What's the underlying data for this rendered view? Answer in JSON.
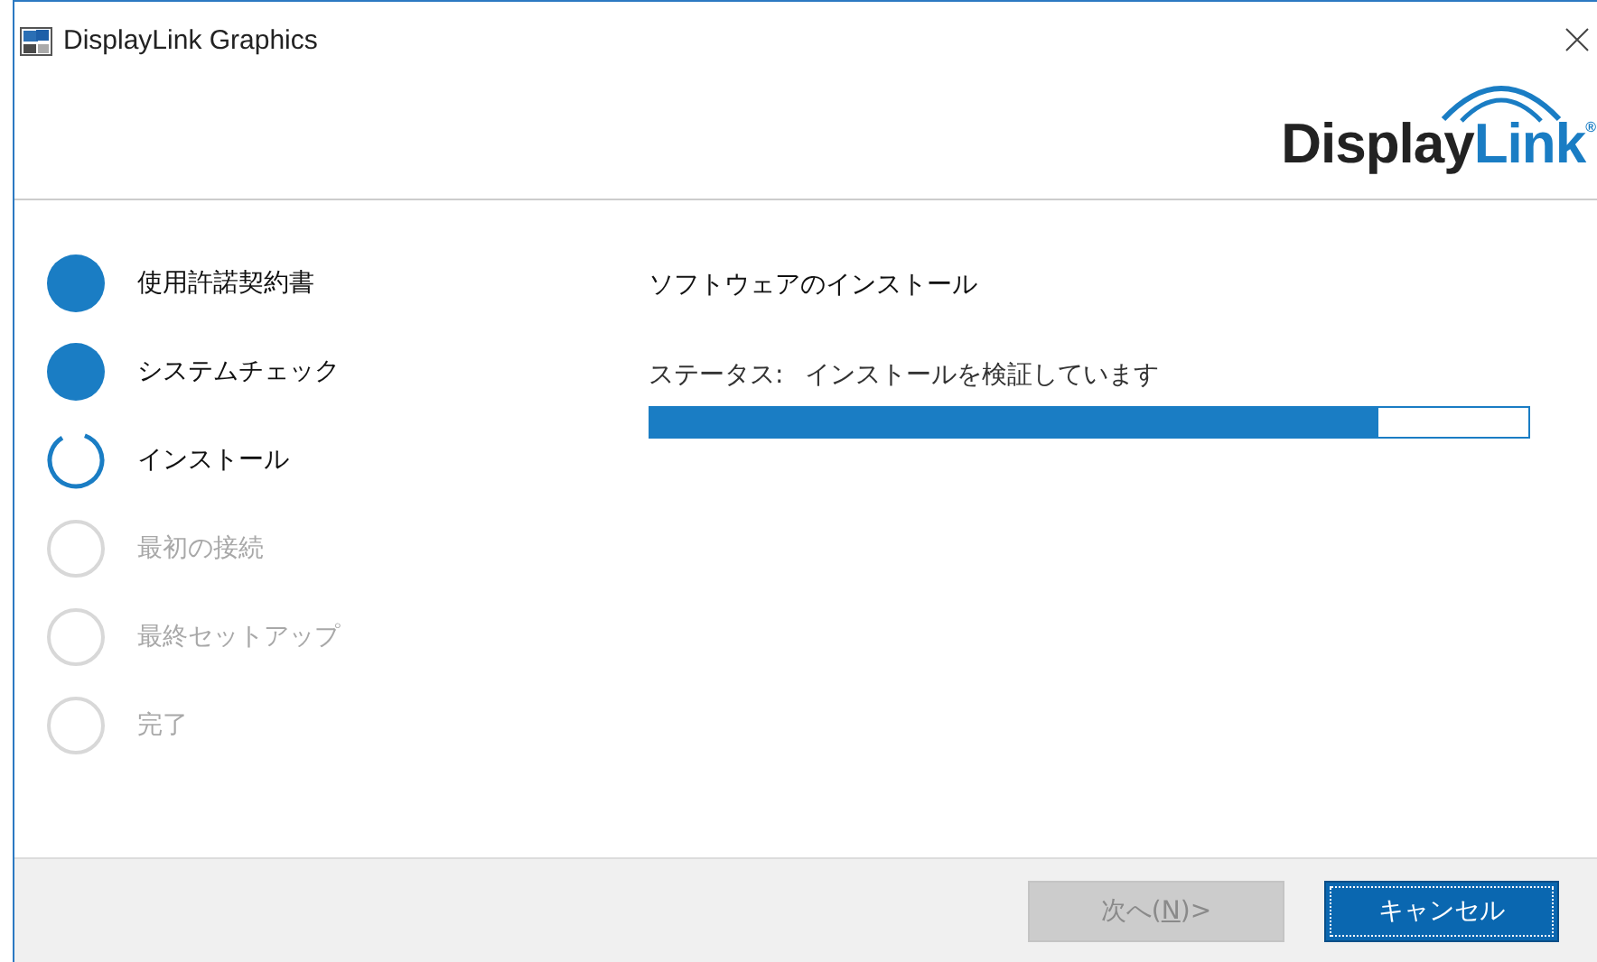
{
  "window": {
    "title": "DisplayLink Graphics"
  },
  "logo": {
    "text_1": "Display",
    "text_2": "Link",
    "mark": "®"
  },
  "steps": [
    {
      "label": "使用許諾契約書",
      "kind": "done"
    },
    {
      "label": "システムチェック",
      "kind": "done"
    },
    {
      "label": "インストール",
      "kind": "current"
    },
    {
      "label": "最初の接続",
      "kind": "pending"
    },
    {
      "label": "最終セットアップ",
      "kind": "pending"
    },
    {
      "label": "完了",
      "kind": "pending"
    }
  ],
  "panel": {
    "heading": "ソフトウェアのインストール",
    "status_label": "ステータス:",
    "status_text": "インストールを検証しています",
    "level": 0.83
  },
  "buttons": [
    {
      "label_before": "次へ(",
      "access_key": "N",
      "label_after": ")>",
      "disabled": true,
      "default": false
    },
    {
      "label_before": "キャンセル",
      "disabled": false,
      "default": true
    }
  ]
}
